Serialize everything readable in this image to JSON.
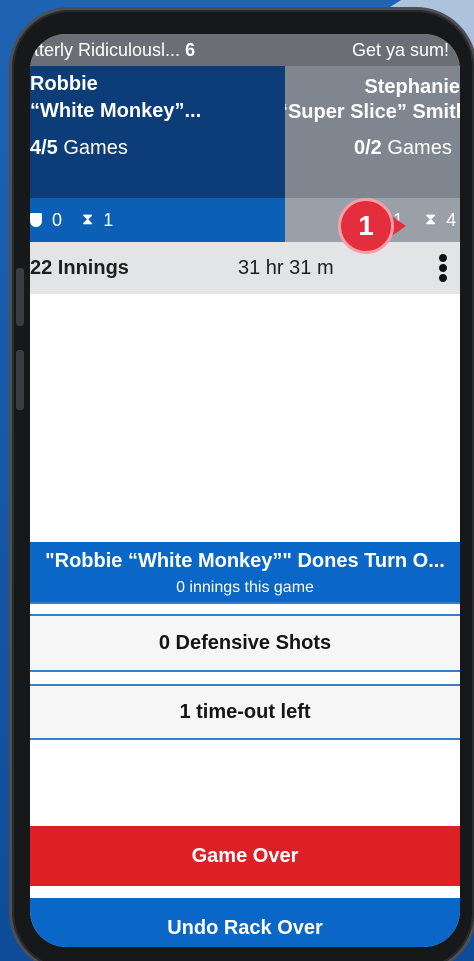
{
  "topbar": {
    "left_text": "tterly Ridiculousl...",
    "left_score": "6",
    "right_text": "Get ya sum! -"
  },
  "player1": {
    "name_line1": "Robbie",
    "name_line2": "“White Monkey”...",
    "games_count": "4/5",
    "games_label": "Games",
    "defensive": "0",
    "timeouts": "1"
  },
  "player2": {
    "name_line1": "Stephanie",
    "name_line2": "“Super Slice” Smith",
    "games_count": "0/2",
    "games_label": "Games",
    "defensive": "1",
    "timeouts": "4"
  },
  "innings": {
    "count": "22 Innings",
    "time": "31 hr 31 m"
  },
  "badge": {
    "number": "1",
    "color": "#e52e3d"
  },
  "turn": {
    "title": "\"Robbie “White Monkey”\" Dones Turn O...",
    "subtitle": "0 innings this game"
  },
  "actions": {
    "defensive_shots": "0 Defensive Shots",
    "timeouts_left": "1 time-out left"
  },
  "buttons": {
    "game_over": "Game Over",
    "undo_rack_over": "Undo Rack Over"
  },
  "colors": {
    "player1_bg": "#0c3d78",
    "accent_blue": "#0a67c7",
    "danger_red": "#dd2025"
  },
  "icons": [
    "shield-icon",
    "hourglass-icon",
    "card-icon",
    "more-vert-icon"
  ]
}
